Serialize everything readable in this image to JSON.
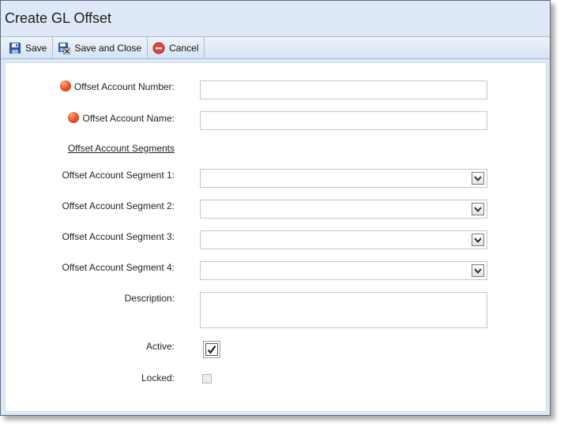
{
  "window": {
    "title": "Create GL Offset"
  },
  "toolbar": {
    "save_label": "Save",
    "save_close_label": "Save and Close",
    "cancel_label": "Cancel",
    "icons": {
      "save": "floppy-disk-icon",
      "save_close": "floppy-disk-close-icon",
      "cancel": "cancel-icon"
    }
  },
  "form": {
    "offset_account_number": {
      "label": "Offset Account Number:",
      "value": "",
      "required": true
    },
    "offset_account_name": {
      "label": "Offset Account Name:",
      "value": "",
      "required": true
    },
    "segments_link": "Offset Account Segments",
    "segments": [
      {
        "label": "Offset Account Segment 1:",
        "value": ""
      },
      {
        "label": "Offset Account Segment 2:",
        "value": ""
      },
      {
        "label": "Offset Account Segment 3:",
        "value": ""
      },
      {
        "label": "Offset Account Segment 4:",
        "value": ""
      }
    ],
    "description": {
      "label": "Description:",
      "value": ""
    },
    "active": {
      "label": "Active:",
      "checked": true
    },
    "locked": {
      "label": "Locked:",
      "checked": false,
      "disabled": true
    }
  },
  "colors": {
    "title_bar_bg": "#dfe8f6",
    "required_indicator": "#f0582a",
    "toolbar_border": "#99bbe8"
  }
}
